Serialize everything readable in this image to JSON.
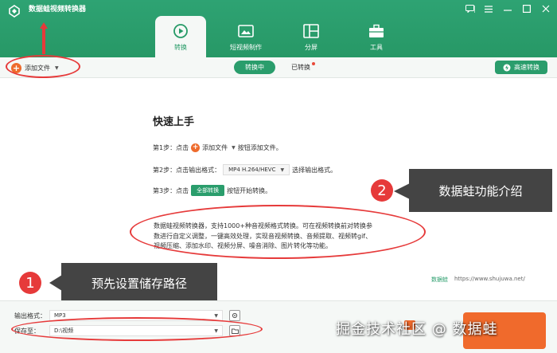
{
  "app": {
    "title": "数据蛙视频转换器"
  },
  "nav": [
    {
      "label": "转换",
      "icon": "convert-icon"
    },
    {
      "label": "短视频制作",
      "icon": "short-video-icon"
    },
    {
      "label": "分屏",
      "icon": "split-screen-icon"
    },
    {
      "label": "工具",
      "icon": "toolbox-icon"
    }
  ],
  "toolbar": {
    "add_file": "添加文件",
    "converting": "转换中",
    "converted": "已转换",
    "hs_convert": "高速转换"
  },
  "quickstart": {
    "title": "快速上手",
    "step1_prefix": "第1步：点击",
    "step1_btn": "添加文件",
    "step1_suffix": "按钮添加文件。",
    "step2_prefix": "第2步：点击输出格式：",
    "step2_format": "MP4 H.264/HEVC",
    "step2_suffix": "选择输出格式。",
    "step3_prefix": "第3步：点击",
    "step3_btn": "全部转换",
    "step3_suffix": "按钮开始转换。",
    "desc_lines": [
      "数据蛙视频转换器，支持1000+种音视频格式转换。可在视频转换前对转换参",
      "数进行自定义调整，一键高效处理，实现音视频转换、音频提取、视频转gif、",
      "视频压缩、添加水印、视频分屏、噪音消除、图片转化等功能。"
    ]
  },
  "site": {
    "brand": "数据蛙",
    "url": "https://www.shujuwa.net/"
  },
  "callouts": {
    "one_num": "1",
    "one_text": "预先设置储存路径",
    "two_num": "2",
    "two_text": "数据蛙功能介绍"
  },
  "bottom": {
    "format_label": "输出格式：",
    "format_value": "MP3",
    "save_label": "保存至：",
    "save_value": "D:\\视频"
  },
  "watermark": "掘金技术社区 @ 数据蛙",
  "colors": {
    "brand_green": "#2a9d6c",
    "accent_red": "#e63a3a",
    "accent_orange": "#f06a2c"
  }
}
